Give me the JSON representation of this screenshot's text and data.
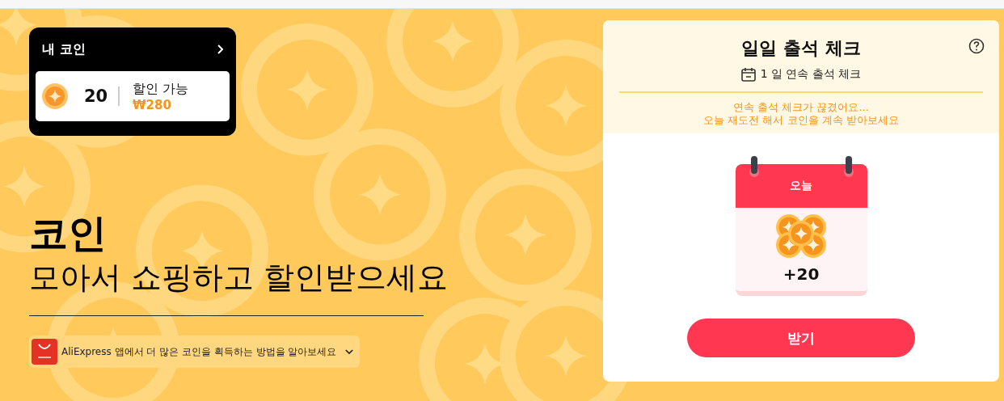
{
  "wallet": {
    "title": "내 코인",
    "coins": "20",
    "discount_label": "할인 가능",
    "discount_value": "₩280"
  },
  "hero": {
    "title": "코인",
    "subtitle": "모아서 쇼핑하고 할인받으세요"
  },
  "app_banner": {
    "text": "AliExpress 앱에서 더 많은 코인을 획득하는 방법을 알아보세요"
  },
  "checkin": {
    "title": "일일 출석 체크",
    "streak": "1 일 연속 출석 체크",
    "messages": [
      "연속 출석 체크가 끊겼어요...",
      "오늘 재도전 해서 코인을 계속 받아보세요"
    ],
    "day_label": "오늘",
    "reward": "+20",
    "button": "받기"
  }
}
